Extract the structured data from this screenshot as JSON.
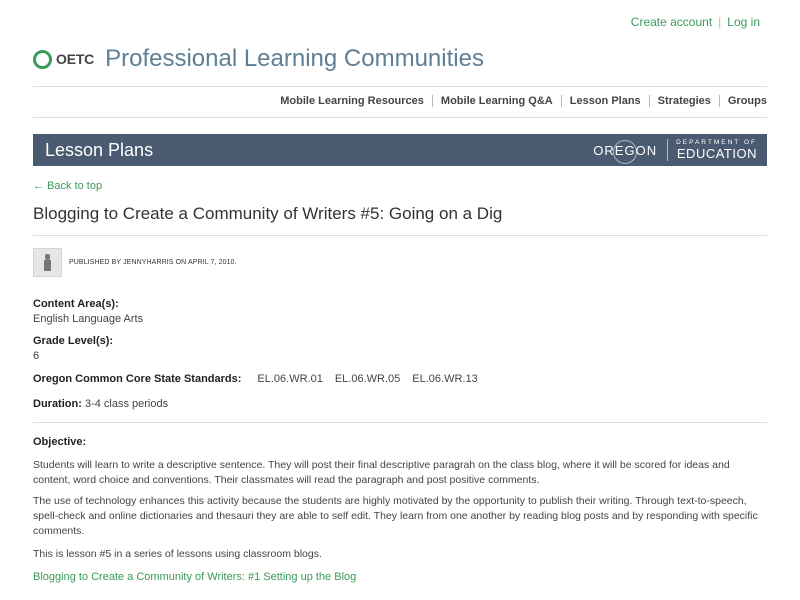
{
  "header": {
    "create_account": "Create account",
    "login": "Log in",
    "logo_text": "OETC",
    "site_title": "Professional Learning Communities"
  },
  "nav": {
    "items": [
      "Mobile Learning Resources",
      "Mobile Learning Q&A",
      "Lesson Plans",
      "Strategies",
      "Groups"
    ]
  },
  "banner": {
    "title": "Lesson Plans",
    "oregon": "OREGON",
    "department_of": "DEPARTMENT OF",
    "education": "EDUCATION"
  },
  "back_link": "← Back to top",
  "lesson": {
    "title": "Blogging to Create a Community of Writers #5: Going on a Dig",
    "byline": "PUBLISHED BY JENNYHARRIS ON APRIL 7, 2010.",
    "content_area_label": "Content Area(s):",
    "content_area_value": "English Language Arts",
    "grade_label": "Grade Level(s):",
    "grade_value": "6",
    "standards_label": "Oregon Common Core State Standards:",
    "standards": [
      "EL.06.WR.01",
      "EL.06.WR.05",
      "EL.06.WR.13"
    ],
    "duration_label": "Duration:",
    "duration_value": "3-4 class periods",
    "objective_label": "Objective:",
    "objective_p1": "Students will learn to write a descriptive sentence.  They will post their final descriptive paragrah on the class blog, where it will be scored for ideas and content, word choice and conventions. Their classmates will read the paragraph and post positive comments.",
    "objective_p2": "The use of technology enhances this activity because the students are highly motivated by the opportunity to publish their writing.  Through text-to-speech, spell-check and online dictionaries and thesauri they are able to self edit.  They learn from one another by reading blog posts and by responding with specific comments.",
    "objective_p3": "This is lesson #5 in a series of lessons using classroom blogs.",
    "series_link": "Blogging to Create a Community of Writers: #1 Setting up the Blog"
  },
  "colors": {
    "accent_green": "#3a9a5a",
    "title_blue": "#5e7f94",
    "banner_bg": "#4a5a70"
  }
}
